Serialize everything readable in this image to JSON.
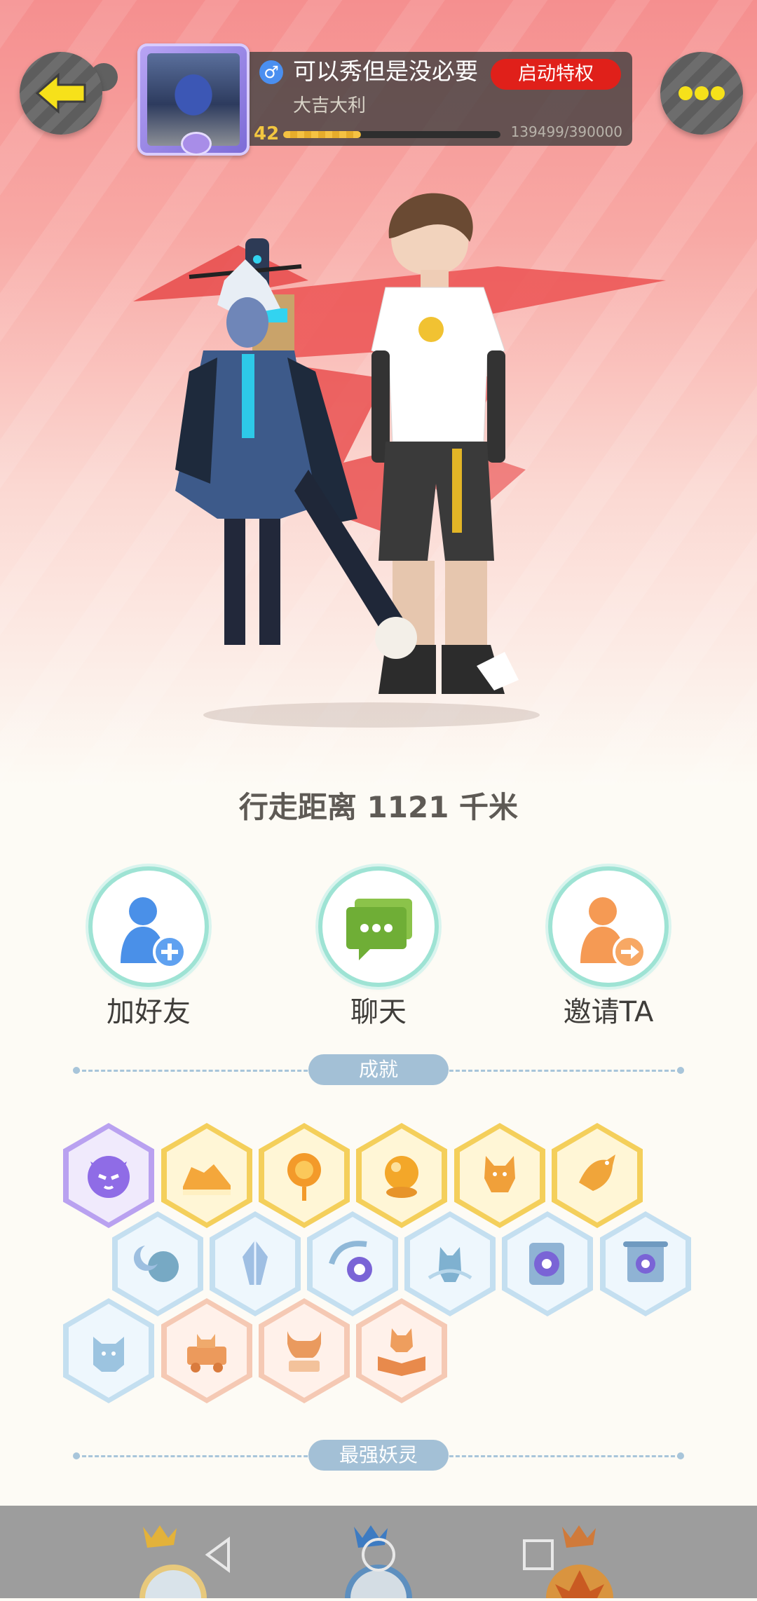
{
  "header": {
    "nickname": "可以秀但是没必要",
    "gender_symbol": "♂",
    "vip_button": "启动特权",
    "signature": "大吉大利",
    "level": "42",
    "xp_text": "139499/390000",
    "xp_progress": 0.358
  },
  "profile": {
    "distance_text": "行走距离 1121 千米"
  },
  "actions": [
    {
      "label": "加好友",
      "icon": "add-friend-icon"
    },
    {
      "label": "聊天",
      "icon": "chat-icon"
    },
    {
      "label": "邀请TA",
      "icon": "invite-icon"
    }
  ],
  "sections": {
    "achievements": "成就",
    "strongest_pets": "最强妖灵"
  },
  "achievement_badges": {
    "row1": [
      "purple-demon-badge",
      "sneaker-badge",
      "sun-lollipop-badge",
      "golden-orb-badge",
      "fox-spirit-badge",
      "golden-bird-badge"
    ],
    "row2": [
      "moon-sphere-badge",
      "crystal-badge",
      "yin-yang-wave-badge",
      "water-spirit-badge",
      "taiji-book-badge",
      "scroll-portal-badge"
    ],
    "row3": [
      "ice-beast-badge",
      "cart-cat-badge",
      "bull-statue-badge",
      "fox-book-badge"
    ]
  },
  "colors": {
    "accent_red": "#e0201a",
    "teal_ring": "#9ee3d4",
    "pill_blue": "#a3c0d6"
  }
}
